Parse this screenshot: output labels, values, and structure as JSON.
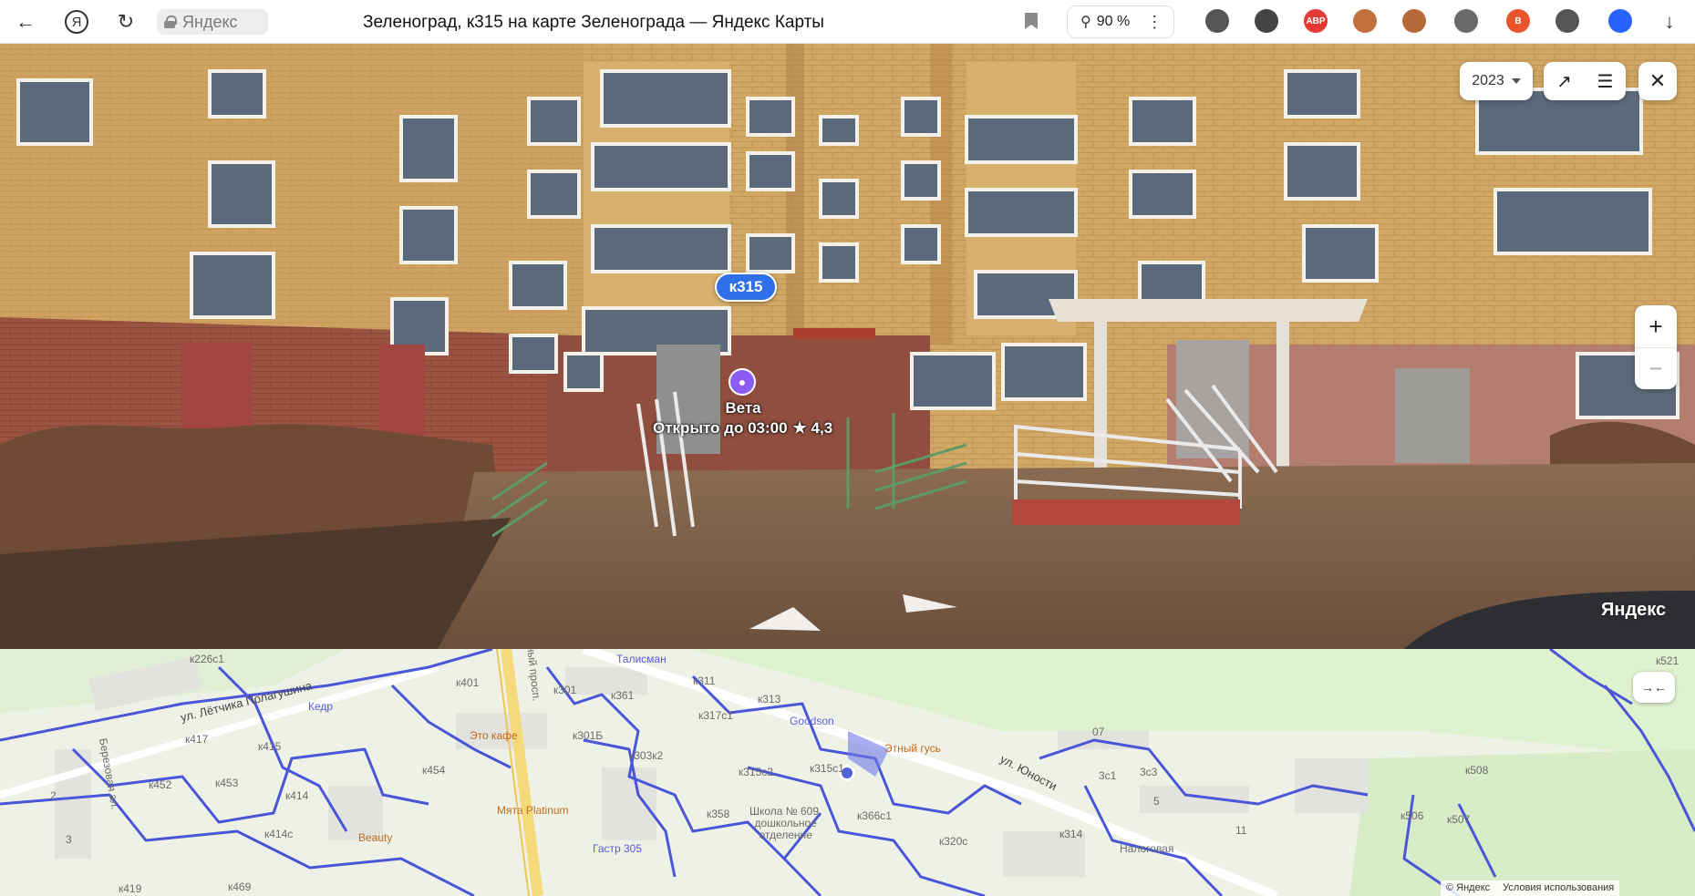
{
  "browser": {
    "brand_letter": "Я",
    "site_name": "Яндекс",
    "page_title": "Зеленоград, к315 на карте Зеленограда — Яндекс Карты",
    "zoom": "90 %",
    "extensions": [
      {
        "name": "ext-dog-icon",
        "color": "#555555",
        "label": ""
      },
      {
        "name": "ext-shield-icon",
        "color": "#444444",
        "label": ""
      },
      {
        "name": "adblock-icon",
        "color": "#e53935",
        "label": "ABP"
      },
      {
        "name": "ext-avatar-icon",
        "color": "#c0703a",
        "label": ""
      },
      {
        "name": "ext-avatar2-icon",
        "color": "#b76a39",
        "label": ""
      },
      {
        "name": "ext-hat-icon",
        "color": "#6a6a6a",
        "label": ""
      },
      {
        "name": "ext-b-icon",
        "color": "#e8542c",
        "label": "B"
      },
      {
        "name": "ext-puzzle-icon",
        "color": "#555555",
        "label": ""
      },
      {
        "name": "ext-translate-icon",
        "color": "#2962ff",
        "label": ""
      }
    ]
  },
  "panorama": {
    "year": "2023",
    "house_label": "к315",
    "poi": {
      "name": "Вета",
      "status": "Открыто до 03:00",
      "rating": "4,3"
    },
    "brand": "Яндекс"
  },
  "map": {
    "labels": {
      "k226c1": "к226с1",
      "letchika": "ул. Лётчика Полагушина",
      "kedr": "Кедр",
      "k401": "к401",
      "k417": "к417",
      "k415": "к415",
      "k452": "к452",
      "k453": "к453",
      "k454": "к454",
      "k414": "к414",
      "k414c": "к414с",
      "k419": "к419",
      "k469": "к469",
      "berez": "Березовая ал.",
      "n2": "2",
      "n3": "3",
      "eto_kafe": "Это кафе",
      "myata": "Мята Platinum",
      "beauty": "Beauty",
      "prosp": "ный просп.",
      "k301": "к301",
      "k301b": "к301Б",
      "k303": "к303к2",
      "k361": "к361",
      "talisman": "Талисман",
      "k311": "к311",
      "k313": "к313",
      "k317": "к317с1",
      "goodson": "Goodson",
      "vkus": "Этный гусь",
      "k315c1": "к315с1",
      "k315c2": "к315с2",
      "school": "Школа № 609,\nдошкольное\nотделение",
      "k358": "к358",
      "k366": "к366с1",
      "k320": "к320с",
      "k314": "к314",
      "gastro": "Гастр 305",
      "yunosti": "ул. Юности",
      "n07": "07",
      "n3c1": "3с1",
      "n3c3": "3с3",
      "n5": "5",
      "n11": "11",
      "nalog": "Налоговая",
      "k508": "к508",
      "k506": "к506",
      "k507": "к507",
      "k521": "к521"
    },
    "collapse_icon": "→←",
    "attribution": "© Яндекс",
    "terms": "Условия использования"
  }
}
